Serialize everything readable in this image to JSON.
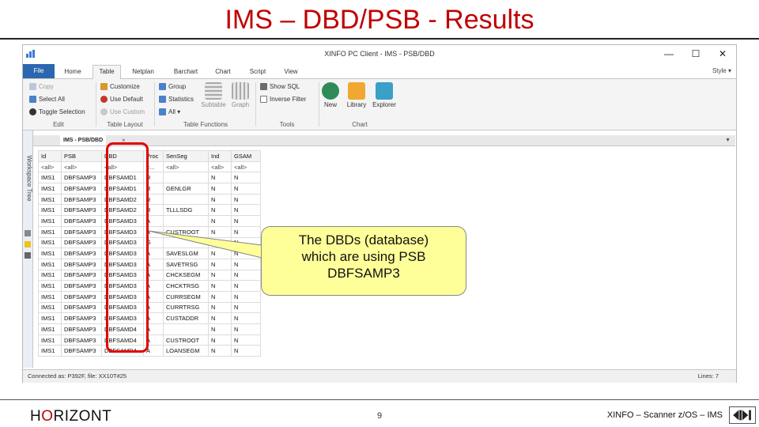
{
  "slide": {
    "title": "IMS – DBD/PSB - Results",
    "footer_logo_1": "H",
    "footer_logo_o": "O",
    "footer_logo_2": "RIZONT",
    "page_number": "9",
    "footer_text": "XINFO – Scanner z/OS – IMS"
  },
  "window": {
    "title": "XINFO PC Client - IMS - PSB/DBD",
    "minimize": "—",
    "maximize": "☐",
    "close": "✕"
  },
  "ribbon_tabs": [
    "File",
    "Home",
    "Table",
    "Netplan",
    "Barchart",
    "Chart",
    "Script",
    "View"
  ],
  "style_menu": "Style ▾",
  "ribbon": {
    "edit": {
      "copy": "Copy",
      "select_all": "Select All",
      "toggle_selection": "Toggle Selection",
      "label": "Edit"
    },
    "table_layout": {
      "customize": "Customize",
      "use_default": "Use Default",
      "use_custom": "Use Custom",
      "label": "Table Layout"
    },
    "table_functions": {
      "group": "Group",
      "statistics": "Statistics",
      "all": "All ▾",
      "subtable": "Subtable",
      "graph": "Graph",
      "label": "Table Functions"
    },
    "tools": {
      "show_sql": "Show SQL",
      "inverse_filter": "Inverse Filter",
      "label": "Tools"
    },
    "chart": {
      "new": "New",
      "library": "Library",
      "explorer": "Explorer",
      "label": "Chart"
    }
  },
  "workspace_label": "Workspace Tree",
  "document_tab": "IMS - PSB/DBD",
  "document_close": "×",
  "table": {
    "columns": [
      "Id",
      "PSB",
      "DBD",
      "Proc",
      "SenSeg",
      "Ind",
      "GSAM"
    ],
    "filters": [
      "<all>",
      "<all>",
      "<all>",
      "<...",
      "<all>",
      "<all>",
      "<all>"
    ],
    "rows": [
      [
        "IMS1",
        "DBFSAMP3",
        "DBFSAMD1",
        "R",
        "",
        "N",
        "N"
      ],
      [
        "IMS1",
        "DBFSAMP3",
        "DBFSAMD1",
        "R",
        "GENLGR",
        "N",
        "N"
      ],
      [
        "IMS1",
        "DBFSAMP3",
        "DBFSAMD2",
        "R",
        "",
        "N",
        "N"
      ],
      [
        "IMS1",
        "DBFSAMP3",
        "DBFSAMD2",
        "R",
        "TLLLSDG",
        "N",
        "N"
      ],
      [
        "IMS1",
        "DBFSAMP3",
        "DBFSAMD3",
        "A",
        "",
        "N",
        "N"
      ],
      [
        "IMS1",
        "DBFSAMP3",
        "DBFSAMD3",
        "A",
        "CUSTROOT",
        "N",
        "N"
      ],
      [
        "IMS1",
        "DBFSAMP3",
        "DBFSAMD3",
        "G",
        "",
        "N",
        "N"
      ],
      [
        "IMS1",
        "DBFSAMP3",
        "DBFSAMD3",
        "A",
        "SAVESLGM",
        "N",
        "N"
      ],
      [
        "IMS1",
        "DBFSAMP3",
        "DBFSAMD3",
        "A",
        "SAVETRSG",
        "N",
        "N"
      ],
      [
        "IMS1",
        "DBFSAMP3",
        "DBFSAMD3",
        "A",
        "CHCKSEGM",
        "N",
        "N"
      ],
      [
        "IMS1",
        "DBFSAMP3",
        "DBFSAMD3",
        "A",
        "CHCKTRSG",
        "N",
        "N"
      ],
      [
        "IMS1",
        "DBFSAMP3",
        "DBFSAMD3",
        "A",
        "CURRSEGM",
        "N",
        "N"
      ],
      [
        "IMS1",
        "DBFSAMP3",
        "DBFSAMD3",
        "A",
        "CURRTRSG",
        "N",
        "N"
      ],
      [
        "IMS1",
        "DBFSAMP3",
        "DBFSAMD3",
        "A",
        "CUSTADDR",
        "N",
        "N"
      ],
      [
        "IMS1",
        "DBFSAMP3",
        "DBFSAMD4",
        "A",
        "",
        "N",
        "N"
      ],
      [
        "IMS1",
        "DBFSAMP3",
        "DBFSAMD4",
        "A",
        "CUSTROOT",
        "N",
        "N"
      ],
      [
        "IMS1",
        "DBFSAMP3",
        "DBFSAMD4",
        "A",
        "LOANSEGM",
        "N",
        "N"
      ]
    ]
  },
  "status": {
    "left": "Connected as: P392F, file: XX10T#25",
    "right": "Lines:  7"
  },
  "callout": {
    "line1": "The DBDs (database)",
    "line2": "which are using PSB",
    "line3": "DBFSAMP3"
  },
  "colors": {
    "title_red": "#c00000",
    "file_tab_blue": "#2b66b0",
    "highlight_red": "#e00000",
    "callout_yellow": "#ffff99"
  }
}
